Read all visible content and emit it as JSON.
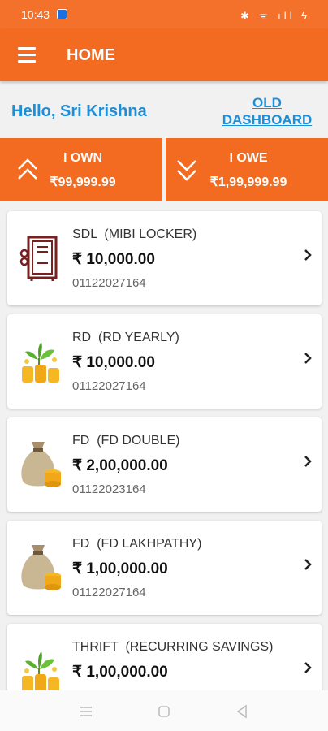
{
  "status_bar": {
    "time": "10:43",
    "icons": "✱ ᯤ ıll ϟ"
  },
  "app_bar": {
    "title": "HOME"
  },
  "greeting": "Hello, Sri Krishna",
  "old_dashboard": {
    "line1": "OLD",
    "line2": "DASHBOARD"
  },
  "summary": {
    "own": {
      "label": "I OWN",
      "amount": "₹99,999.99"
    },
    "owe": {
      "label": "I OWE",
      "amount": "₹1,99,999.99"
    }
  },
  "accounts": [
    {
      "title": "SDL  (MIBI LOCKER)",
      "amount": "₹ 10,000.00",
      "account_no": "01122027164",
      "icon": "locker-icon"
    },
    {
      "title": "RD  (RD YEARLY)",
      "amount": "₹ 10,000.00",
      "account_no": "01122027164",
      "icon": "plant-coins-icon"
    },
    {
      "title": "FD  (FD DOUBLE)",
      "amount": "₹ 2,00,000.00",
      "account_no": "01122023164",
      "icon": "money-bag-icon"
    },
    {
      "title": "FD  (FD LAKHPATHY)",
      "amount": "₹ 1,00,000.00",
      "account_no": "01122027164",
      "icon": "money-bag-icon"
    },
    {
      "title": "THRIFT  (RECURRING SAVINGS)",
      "amount": "₹ 1,00,000.00",
      "account_no": "",
      "icon": "plant-coins-icon"
    }
  ],
  "colors": {
    "primary": "#f26b21",
    "link": "#1d8ed8"
  }
}
